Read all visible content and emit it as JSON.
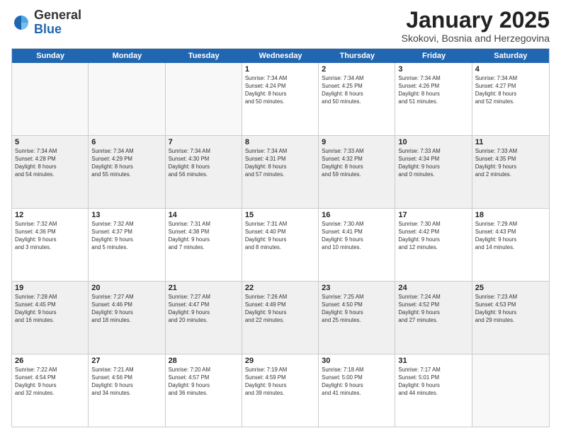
{
  "logo": {
    "general": "General",
    "blue": "Blue"
  },
  "title": {
    "month": "January 2025",
    "location": "Skokovi, Bosnia and Herzegovina"
  },
  "days": [
    "Sunday",
    "Monday",
    "Tuesday",
    "Wednesday",
    "Thursday",
    "Friday",
    "Saturday"
  ],
  "weeks": [
    [
      {
        "day": "",
        "info": ""
      },
      {
        "day": "",
        "info": ""
      },
      {
        "day": "",
        "info": ""
      },
      {
        "day": "1",
        "info": "Sunrise: 7:34 AM\nSunset: 4:24 PM\nDaylight: 8 hours\nand 50 minutes."
      },
      {
        "day": "2",
        "info": "Sunrise: 7:34 AM\nSunset: 4:25 PM\nDaylight: 8 hours\nand 50 minutes."
      },
      {
        "day": "3",
        "info": "Sunrise: 7:34 AM\nSunset: 4:26 PM\nDaylight: 8 hours\nand 51 minutes."
      },
      {
        "day": "4",
        "info": "Sunrise: 7:34 AM\nSunset: 4:27 PM\nDaylight: 8 hours\nand 52 minutes."
      }
    ],
    [
      {
        "day": "5",
        "info": "Sunrise: 7:34 AM\nSunset: 4:28 PM\nDaylight: 8 hours\nand 54 minutes."
      },
      {
        "day": "6",
        "info": "Sunrise: 7:34 AM\nSunset: 4:29 PM\nDaylight: 8 hours\nand 55 minutes."
      },
      {
        "day": "7",
        "info": "Sunrise: 7:34 AM\nSunset: 4:30 PM\nDaylight: 8 hours\nand 56 minutes."
      },
      {
        "day": "8",
        "info": "Sunrise: 7:34 AM\nSunset: 4:31 PM\nDaylight: 8 hours\nand 57 minutes."
      },
      {
        "day": "9",
        "info": "Sunrise: 7:33 AM\nSunset: 4:32 PM\nDaylight: 8 hours\nand 59 minutes."
      },
      {
        "day": "10",
        "info": "Sunrise: 7:33 AM\nSunset: 4:34 PM\nDaylight: 9 hours\nand 0 minutes."
      },
      {
        "day": "11",
        "info": "Sunrise: 7:33 AM\nSunset: 4:35 PM\nDaylight: 9 hours\nand 2 minutes."
      }
    ],
    [
      {
        "day": "12",
        "info": "Sunrise: 7:32 AM\nSunset: 4:36 PM\nDaylight: 9 hours\nand 3 minutes."
      },
      {
        "day": "13",
        "info": "Sunrise: 7:32 AM\nSunset: 4:37 PM\nDaylight: 9 hours\nand 5 minutes."
      },
      {
        "day": "14",
        "info": "Sunrise: 7:31 AM\nSunset: 4:38 PM\nDaylight: 9 hours\nand 7 minutes."
      },
      {
        "day": "15",
        "info": "Sunrise: 7:31 AM\nSunset: 4:40 PM\nDaylight: 9 hours\nand 8 minutes."
      },
      {
        "day": "16",
        "info": "Sunrise: 7:30 AM\nSunset: 4:41 PM\nDaylight: 9 hours\nand 10 minutes."
      },
      {
        "day": "17",
        "info": "Sunrise: 7:30 AM\nSunset: 4:42 PM\nDaylight: 9 hours\nand 12 minutes."
      },
      {
        "day": "18",
        "info": "Sunrise: 7:29 AM\nSunset: 4:43 PM\nDaylight: 9 hours\nand 14 minutes."
      }
    ],
    [
      {
        "day": "19",
        "info": "Sunrise: 7:28 AM\nSunset: 4:45 PM\nDaylight: 9 hours\nand 16 minutes."
      },
      {
        "day": "20",
        "info": "Sunrise: 7:27 AM\nSunset: 4:46 PM\nDaylight: 9 hours\nand 18 minutes."
      },
      {
        "day": "21",
        "info": "Sunrise: 7:27 AM\nSunset: 4:47 PM\nDaylight: 9 hours\nand 20 minutes."
      },
      {
        "day": "22",
        "info": "Sunrise: 7:26 AM\nSunset: 4:49 PM\nDaylight: 9 hours\nand 22 minutes."
      },
      {
        "day": "23",
        "info": "Sunrise: 7:25 AM\nSunset: 4:50 PM\nDaylight: 9 hours\nand 25 minutes."
      },
      {
        "day": "24",
        "info": "Sunrise: 7:24 AM\nSunset: 4:52 PM\nDaylight: 9 hours\nand 27 minutes."
      },
      {
        "day": "25",
        "info": "Sunrise: 7:23 AM\nSunset: 4:53 PM\nDaylight: 9 hours\nand 29 minutes."
      }
    ],
    [
      {
        "day": "26",
        "info": "Sunrise: 7:22 AM\nSunset: 4:54 PM\nDaylight: 9 hours\nand 32 minutes."
      },
      {
        "day": "27",
        "info": "Sunrise: 7:21 AM\nSunset: 4:56 PM\nDaylight: 9 hours\nand 34 minutes."
      },
      {
        "day": "28",
        "info": "Sunrise: 7:20 AM\nSunset: 4:57 PM\nDaylight: 9 hours\nand 36 minutes."
      },
      {
        "day": "29",
        "info": "Sunrise: 7:19 AM\nSunset: 4:59 PM\nDaylight: 9 hours\nand 39 minutes."
      },
      {
        "day": "30",
        "info": "Sunrise: 7:18 AM\nSunset: 5:00 PM\nDaylight: 9 hours\nand 41 minutes."
      },
      {
        "day": "31",
        "info": "Sunrise: 7:17 AM\nSunset: 5:01 PM\nDaylight: 9 hours\nand 44 minutes."
      },
      {
        "day": "",
        "info": ""
      }
    ]
  ]
}
